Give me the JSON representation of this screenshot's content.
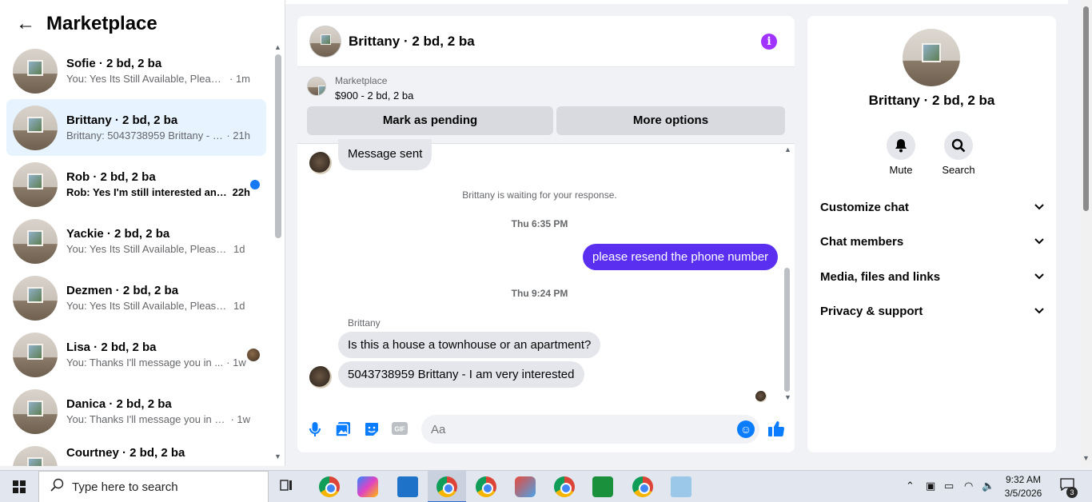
{
  "sidebar": {
    "title": "Marketplace",
    "conversations": [
      {
        "name": "Sofie · 2 bd, 2 ba",
        "preview": "You: Yes Its Still Available, Please S...",
        "time": "· 1m"
      },
      {
        "name": "Brittany · 2 bd, 2 ba",
        "preview": "Brittany: 5043738959 Brittany - I a...",
        "time": "· 21h"
      },
      {
        "name": "Rob · 2 bd, 2 ba",
        "preview": "Rob: Yes I'm still interested and...",
        "time": "22h"
      },
      {
        "name": "Yackie · 2 bd, 2 ba",
        "preview": "You: Yes Its Still Available, Please Se...",
        "time": "1d"
      },
      {
        "name": "Dezmen · 2 bd, 2 ba",
        "preview": "You: Yes Its Still Available, Please Se...",
        "time": "1d"
      },
      {
        "name": "Lisa · 2 bd, 2 ba",
        "preview": "You: Thanks I'll message you in ...",
        "time": "· 1w"
      },
      {
        "name": "Danica · 2 bd, 2 ba",
        "preview": "You: Thanks I'll message you in a ...",
        "time": "· 1w"
      },
      {
        "name": "Courtney · 2 bd, 2 ba",
        "preview": "",
        "time": ""
      }
    ]
  },
  "chat": {
    "title": "Brittany · 2 bd, 2 ba",
    "listing": {
      "source": "Marketplace",
      "price": "$900 - 2 bd, 2 ba",
      "pending_label": "Mark as pending",
      "more_label": "More options"
    },
    "messages": {
      "sent_notice": "Message sent",
      "waiting": "Brittany is waiting for your response.",
      "ts1": "Thu 6:35 PM",
      "out1": "please resend the phone number",
      "ts2": "Thu 9:24 PM",
      "sender": "Brittany",
      "in1": "Is this a house a townhouse or an apartment?",
      "in2": "5043738959 Brittany - I am very interested"
    },
    "composer": {
      "placeholder": "Aa"
    }
  },
  "details": {
    "name": "Brittany · 2 bd, 2 ba",
    "mute_label": "Mute",
    "search_label": "Search",
    "sections": [
      "Customize chat",
      "Chat members",
      "Media, files and links",
      "Privacy & support"
    ]
  },
  "taskbar": {
    "search_placeholder": "Type here to search",
    "time": "9:32 AM",
    "date": "3/5/2026",
    "notifications": "3"
  },
  "colors": {
    "accent": "#0a7cff",
    "outgoing_bubble": "#5a2ff0",
    "active_conv": "#e7f3ff",
    "unread_dot": "#1877f2"
  }
}
